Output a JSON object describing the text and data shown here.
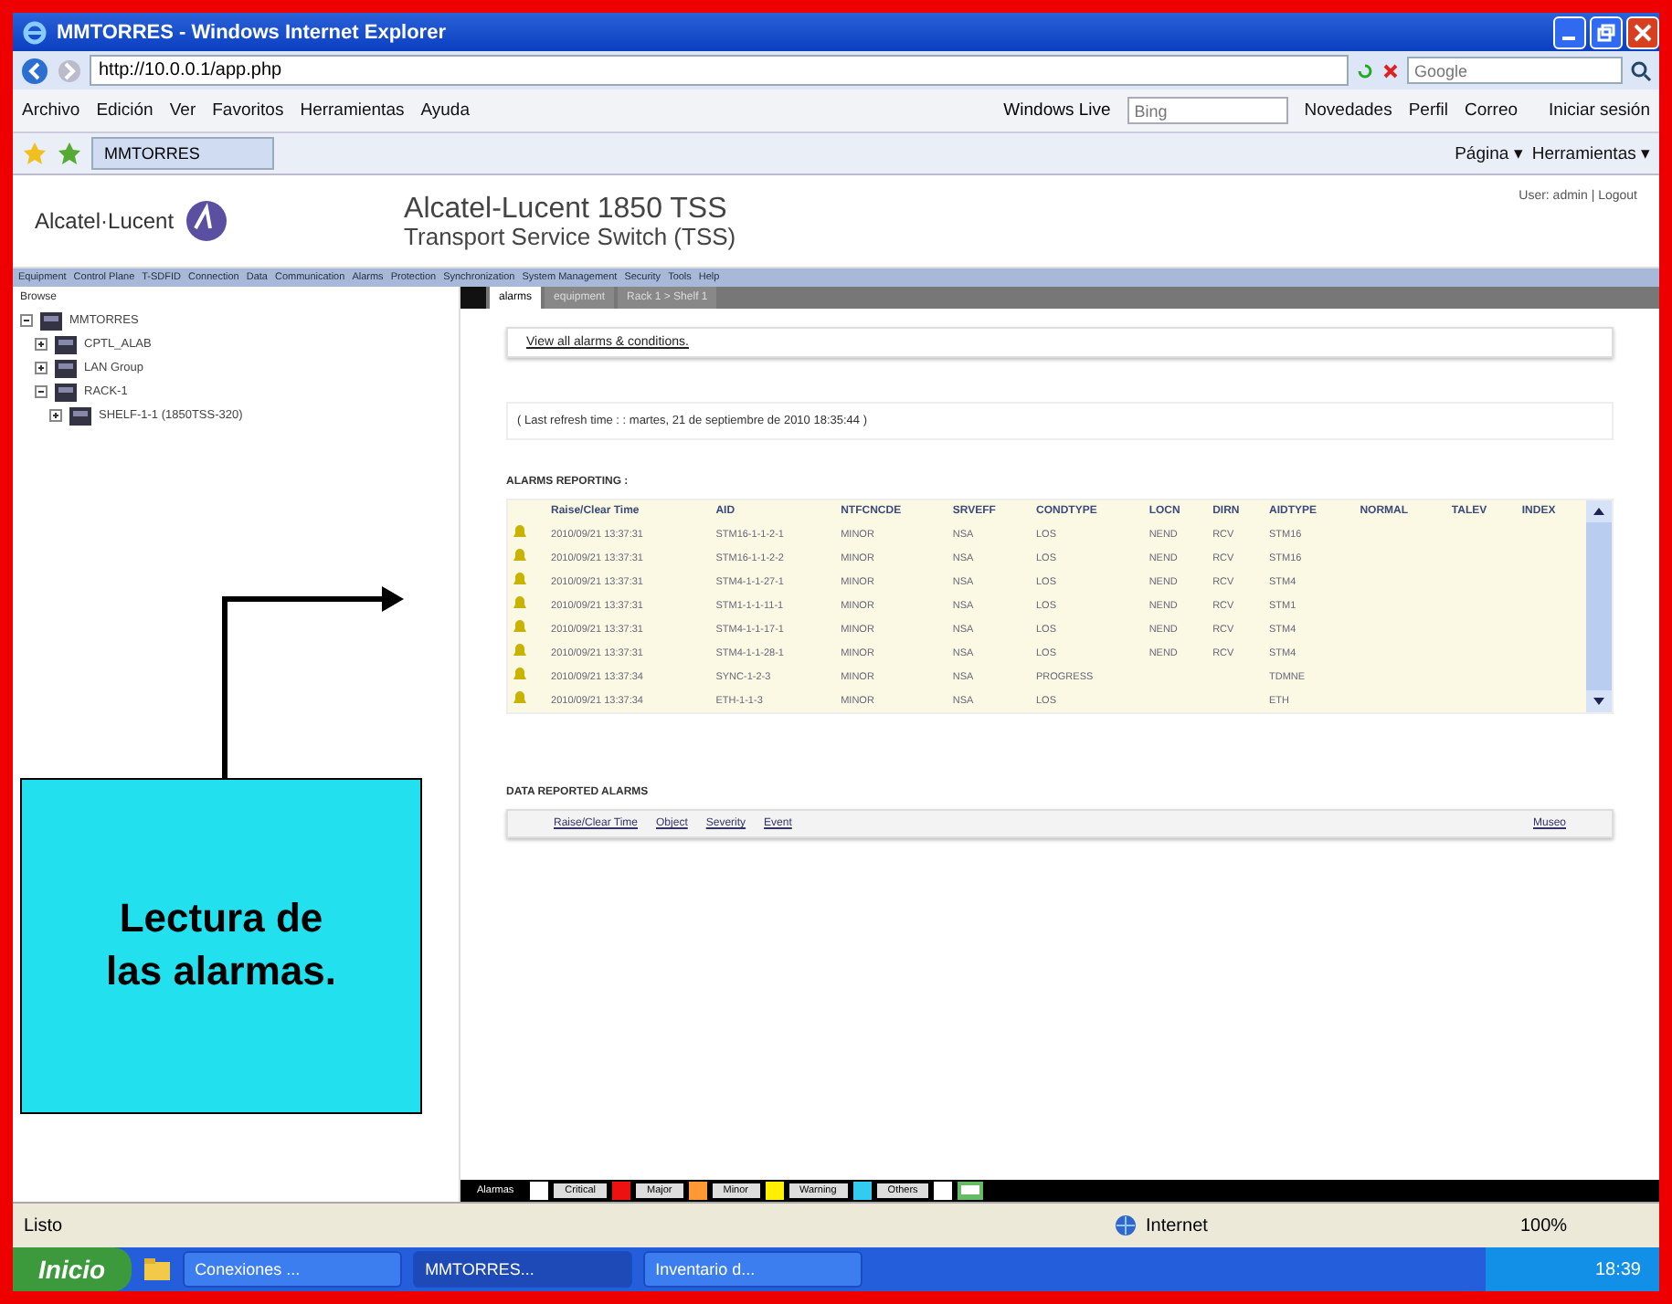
{
  "window": {
    "title": "MMTORRES - Windows Internet Explorer"
  },
  "address_bar": {
    "url": "http://10.0.0.1/app.php",
    "search_placeholder": "Google"
  },
  "menu": [
    "Archivo",
    "Edición",
    "Ver",
    "Favoritos",
    "Herramientas",
    "Ayuda"
  ],
  "live_bar": {
    "brand": "Windows Live",
    "search_placeholder": "Bing",
    "links": [
      "Novedades",
      "Perfil",
      "Correo"
    ],
    "signin": "Iniciar sesión"
  },
  "favorites_bar": {
    "tab": "MMTORRES",
    "commands": [
      "Página ▾",
      "Herramientas ▾"
    ]
  },
  "app": {
    "logo": "Alcatel·Lucent",
    "title": "Alcatel-Lucent 1850 TSS",
    "subtitle": "Transport Service Switch (TSS)",
    "user": "User: admin | Logout",
    "nav": [
      "Equipment",
      "Control Plane",
      "T-SDFID",
      "Connection",
      "Data",
      "Communication",
      "Alarms",
      "Protection",
      "Synchronization",
      "System Management",
      "Security",
      "Tools",
      "Help"
    ],
    "tree_title": "Browse",
    "tree": [
      {
        "label": "MMTORRES",
        "expanded": true,
        "children": [
          {
            "label": "CPTL_ALAB",
            "expanded": false
          },
          {
            "label": "LAN Group",
            "expanded": false
          },
          {
            "label": "RACK-1",
            "expanded": true,
            "children": [
              {
                "label": "SHELF-1-1 (1850TSS-320)",
                "expanded": false
              }
            ]
          }
        ]
      }
    ],
    "tabs": [
      {
        "label": "alarms",
        "selected": true
      },
      {
        "label": "equipment",
        "selected": false
      },
      {
        "label": "Rack 1 > Shelf 1",
        "selected": false
      }
    ],
    "view_all_link": "View all alarms & conditions.",
    "refresh": "( Last refresh time : : martes, 21 de septiembre de 2010 18:35:44 )",
    "alarms_title": "ALARMS REPORTING :",
    "alarm_columns": [
      "Raise/Clear Time",
      "AID",
      "NTFCNCDE",
      "SRVEFF",
      "CONDTYPE",
      "LOCN",
      "DIRN",
      "AIDTYPE",
      "NORMAL",
      "TALEV",
      "INDEX"
    ],
    "alarm_rows": [
      [
        "2010/09/21 13:37:31",
        "STM16-1-1-2-1",
        "MINOR",
        "NSA",
        "LOS",
        "NEND",
        "RCV",
        "STM16"
      ],
      [
        "2010/09/21 13:37:31",
        "STM16-1-1-2-2",
        "MINOR",
        "NSA",
        "LOS",
        "NEND",
        "RCV",
        "STM16"
      ],
      [
        "2010/09/21 13:37:31",
        "STM4-1-1-27-1",
        "MINOR",
        "NSA",
        "LOS",
        "NEND",
        "RCV",
        "STM4"
      ],
      [
        "2010/09/21 13:37:31",
        "STM1-1-1-11-1",
        "MINOR",
        "NSA",
        "LOS",
        "NEND",
        "RCV",
        "STM1"
      ],
      [
        "2010/09/21 13:37:31",
        "STM4-1-1-17-1",
        "MINOR",
        "NSA",
        "LOS",
        "NEND",
        "RCV",
        "STM4"
      ],
      [
        "2010/09/21 13:37:31",
        "STM4-1-1-28-1",
        "MINOR",
        "NSA",
        "LOS",
        "NEND",
        "RCV",
        "STM4"
      ],
      [
        "2010/09/21 13:37:34",
        "SYNC-1-2-3",
        "MINOR",
        "NSA",
        "PROGRESS",
        "",
        "",
        "TDMNE"
      ],
      [
        "2010/09/21 13:37:34",
        "ETH-1-1-3",
        "MINOR",
        "NSA",
        "LOS",
        "",
        "",
        "ETH"
      ]
    ],
    "data_title": "DATA REPORTED ALARMS",
    "data_columns": [
      "Raise/Clear Time",
      "Object",
      "Severity",
      "Event"
    ],
    "data_action": "Museo",
    "legend": [
      {
        "label": "Alarmas",
        "color": "#ffffff"
      },
      {
        "label": "Critical",
        "color": "#ee1111"
      },
      {
        "label": "Major",
        "color": "#ff9933"
      },
      {
        "label": "Minor",
        "color": "#ffee00"
      },
      {
        "label": "Warning",
        "color": "#33ccee"
      },
      {
        "label": "Others",
        "color": "#ffffff"
      }
    ]
  },
  "callout": {
    "text": "Lectura de las alarmas."
  },
  "status_bar": {
    "text": "Listo",
    "zone": "Internet",
    "zoom": "100%"
  },
  "taskbar": {
    "start": "Inicio",
    "tasks": [
      {
        "label": "Conexiones ...",
        "selected": false
      },
      {
        "label": "MMTORRES...",
        "selected": true
      },
      {
        "label": "Inventario d...",
        "selected": false
      }
    ],
    "clock": "18:39"
  }
}
